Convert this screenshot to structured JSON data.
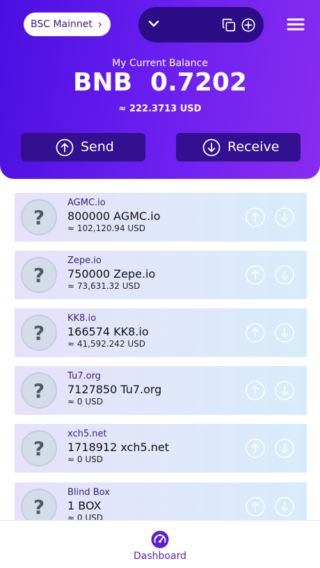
{
  "header": {
    "network_label": "BSC Mainnet",
    "balance_label": "My Current Balance",
    "balance_symbol": "BNB",
    "balance_value": "0.7202",
    "balance_usd": "≈ 222.3713 USD",
    "send_label": "Send",
    "receive_label": "Receive",
    "icons": [
      "chevron-right-icon",
      "chevron-down-icon",
      "copy-icon",
      "add-circle-icon",
      "hamburger-menu-icon",
      "arrow-up-circle-icon",
      "arrow-down-circle-icon"
    ]
  },
  "tokens": [
    {
      "name": "AGMC.io",
      "amount": "800000 AGMC.io",
      "usd": "≈ 102,120.94 USD"
    },
    {
      "name": "Zepe.io",
      "amount": "750000 Zepe.io",
      "usd": "≈ 73,631.32 USD"
    },
    {
      "name": "KK8.io",
      "amount": "166574 KK8.io",
      "usd": "≈ 41,592.242 USD"
    },
    {
      "name": "Tu7.org",
      "amount": "7127850 Tu7.org",
      "usd": "≈ 0 USD"
    },
    {
      "name": "xch5.net",
      "amount": "1718912 xch5.net",
      "usd": "≈ 0 USD"
    },
    {
      "name": "Blind Box",
      "amount": "1 BOX",
      "usd": "≈ 0 USD"
    }
  ],
  "token_placeholder_glyph": "?",
  "nav": {
    "dashboard_label": "Dashboard",
    "dashboard_icon": "speedometer-icon"
  },
  "colors": {
    "header_gradient": [
      "#4a0fe0",
      "#8a2cf0"
    ],
    "button_bg": "#33108f",
    "accent": "#5a1fd6",
    "card_gradient": [
      "#e6e1fb",
      "#d7ecfa"
    ]
  }
}
